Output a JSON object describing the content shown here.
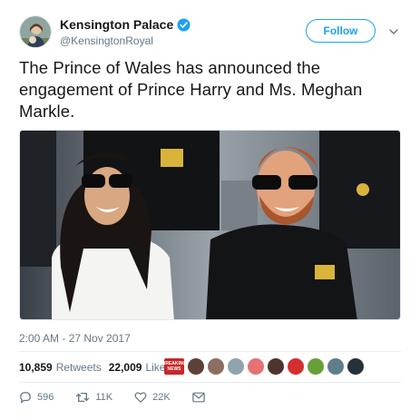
{
  "header": {
    "display_name": "Kensington Palace",
    "handle": "@KensingtonRoyal",
    "follow_label": "Follow"
  },
  "tweet": {
    "text": "The Prince of Wales has announced the engagement of Prince Harry and Ms. Meghan Markle.",
    "timestamp": "2:00 AM - 27 Nov 2017"
  },
  "photo": {
    "badge_text": "INVICTUS GAMES"
  },
  "stats": {
    "retweets_count": "10,859",
    "retweets_label": "Retweets",
    "likes_count": "22,009",
    "likes_label": "Likes"
  },
  "likers": [
    {
      "color": "#c62828",
      "label": "BREAKING NEWS"
    },
    {
      "color": "#5d4037",
      "label": ""
    },
    {
      "color": "#8d6e63",
      "label": ""
    },
    {
      "color": "#90a4ae",
      "label": ""
    },
    {
      "color": "#e57373",
      "label": ""
    },
    {
      "color": "#4e342e",
      "label": ""
    },
    {
      "color": "#d32f2f",
      "label": ""
    },
    {
      "color": "#689f38",
      "label": ""
    },
    {
      "color": "#607d8b",
      "label": ""
    },
    {
      "color": "#263238",
      "label": ""
    }
  ],
  "actions": {
    "replies": "596",
    "retweets": "11K",
    "likes": "22K"
  },
  "colors": {
    "accent": "#1da1f2",
    "text": "#14171a",
    "secondary": "#657786"
  },
  "icons": [
    "verified-badge-icon",
    "chevron-down-icon",
    "reply-icon",
    "retweet-icon",
    "like-icon",
    "message-icon"
  ]
}
